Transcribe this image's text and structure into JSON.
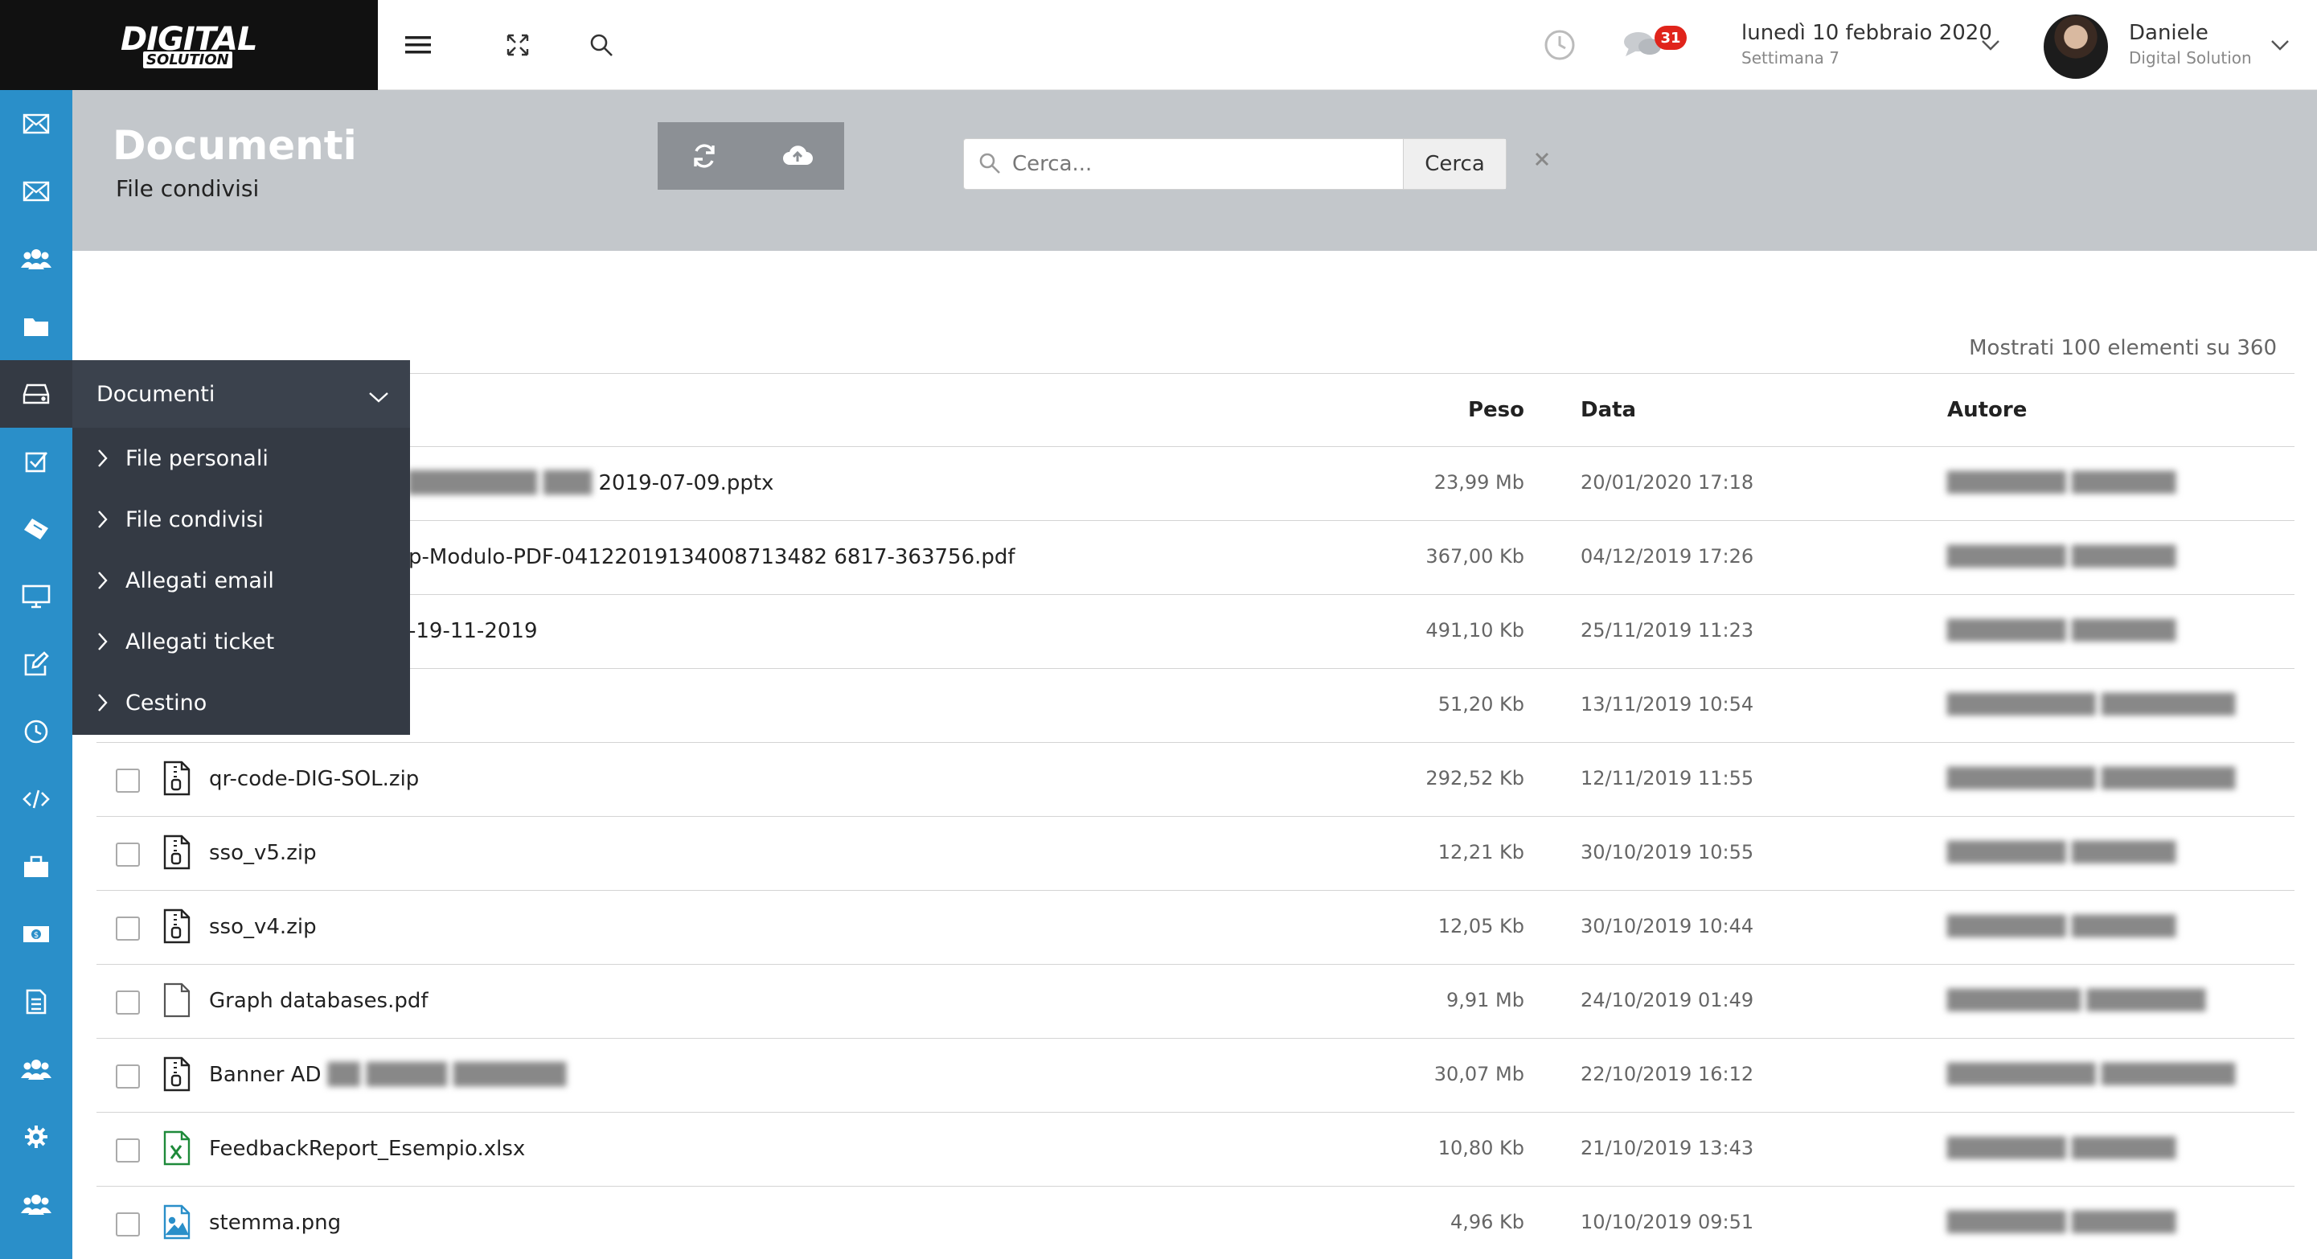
{
  "brand": {
    "logo_line1": "DIGITAL",
    "logo_line2": "SOLUTION",
    "dark": "#111111",
    "accent": "#2a8fc9"
  },
  "topbar": {
    "icons": [
      "menu-icon",
      "expand-icon",
      "search-icon",
      "clock-icon",
      "chat-icon"
    ],
    "notifications_count": "31",
    "date": "lunedì 10 febbraio 2020",
    "week": "Settimana 7",
    "user_name": "Daniele",
    "user_org": "Digital Solution"
  },
  "sidebar": {
    "icons": [
      "mail-icon",
      "mail-icon",
      "users-icon",
      "folder-icon",
      "inbox-icon",
      "checkbox-icon",
      "ticket-icon",
      "monitor-icon",
      "edit-icon",
      "clock-icon",
      "code-icon",
      "briefcase-icon",
      "money-icon",
      "document-icon",
      "users-icon",
      "gear-icon",
      "users-icon"
    ],
    "active_index": 4
  },
  "header": {
    "title": "Documenti",
    "subtitle": "File condivisi",
    "toolbar": [
      "refresh-icon",
      "cloud-upload-icon"
    ],
    "search_placeholder": "Cerca...",
    "search_button": "Cerca"
  },
  "menu": {
    "title": "Documenti",
    "items": [
      "File personali",
      "File condivisi",
      "Allegati email",
      "Allegati ticket",
      "Cestino"
    ]
  },
  "list": {
    "count_label": "Mostrati 100 elementi su 360",
    "columns": {
      "size": "Peso",
      "date": "Data",
      "author": "Autore"
    },
    "rows": [
      {
        "name": "2019-07-09.pptx",
        "size": "23,99 Mb",
        "date": "20/01/2020 17:18",
        "icon": "file-icon"
      },
      {
        "name": "p-Modulo-PDF-04122019134008713482 6817-363756.pdf",
        "size": "367,00 Kb",
        "date": "04/12/2019 17:26",
        "icon": "file-icon"
      },
      {
        "name": "-19-11-2019",
        "size": "491,10 Kb",
        "date": "25/11/2019 11:23",
        "icon": "file-icon"
      },
      {
        "name": "",
        "size": "51,20 Kb",
        "date": "13/11/2019 10:54",
        "icon": "file-icon"
      },
      {
        "name": "qr-code-DIG-SOL.zip",
        "size": "292,52 Kb",
        "date": "12/11/2019 11:55",
        "icon": "zip-icon"
      },
      {
        "name": "sso_v5.zip",
        "size": "12,21 Kb",
        "date": "30/10/2019 10:55",
        "icon": "zip-icon"
      },
      {
        "name": "sso_v4.zip",
        "size": "12,05 Kb",
        "date": "30/10/2019 10:44",
        "icon": "zip-icon"
      },
      {
        "name": "Graph databases.pdf",
        "size": "9,91 Mb",
        "date": "24/10/2019 01:49",
        "icon": "file-icon"
      },
      {
        "name": "Banner AD",
        "size": "30,07 Mb",
        "date": "22/10/2019 16:12",
        "icon": "zip-icon"
      },
      {
        "name": "FeedbackReport_Esempio.xlsx",
        "size": "10,80 Kb",
        "date": "21/10/2019 13:43",
        "icon": "excel-icon"
      },
      {
        "name": "stemma.png",
        "size": "4,96 Kb",
        "date": "10/10/2019 09:51",
        "icon": "image-icon"
      }
    ]
  }
}
